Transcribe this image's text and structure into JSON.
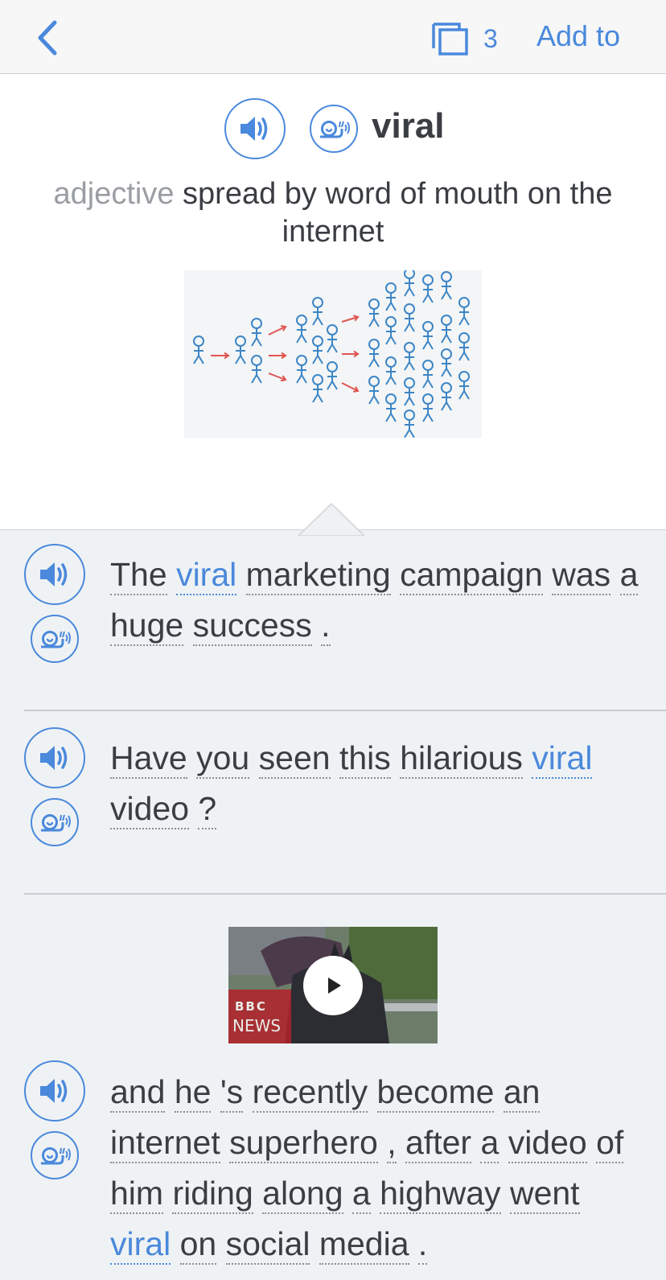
{
  "topbar": {
    "card_count": "3",
    "add_to_label": "Add to",
    "back_icon": "chevron-left-icon",
    "cards_icon": "stacked-cards-icon",
    "accent": "#4a89dc"
  },
  "entry": {
    "word": "viral",
    "part_of_speech": "adjective",
    "definition": "spread by word of mouth on the internet",
    "illustration": "stick-figure-spread-illustration"
  },
  "examples": [
    {
      "words": [
        "The",
        "viral",
        "marketing",
        "campaign",
        "was",
        "a",
        "huge",
        "success",
        "."
      ]
    },
    {
      "words": [
        "Have",
        "you",
        "seen",
        "this",
        "hilarious",
        "viral",
        "video",
        "?"
      ]
    },
    {
      "video": {
        "logo_line1": "BBC",
        "logo_line2": "NEWS"
      },
      "words": [
        "and",
        "he",
        "'s",
        "recently",
        "become",
        "an",
        "internet",
        "superhero",
        ",",
        "after",
        "a",
        "video",
        "of",
        "him",
        "riding",
        "along",
        "a",
        "highway",
        "went",
        "viral",
        "on",
        "social",
        "media",
        "."
      ]
    }
  ]
}
